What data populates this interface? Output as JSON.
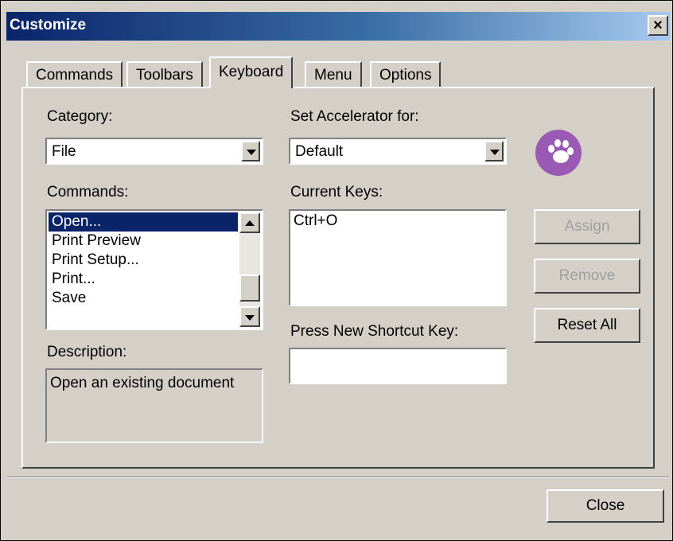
{
  "window": {
    "title": "Customize"
  },
  "tabs": [
    {
      "label": "Commands"
    },
    {
      "label": "Toolbars"
    },
    {
      "label": "Keyboard"
    },
    {
      "label": "Menu"
    },
    {
      "label": "Options"
    }
  ],
  "active_tab": "Keyboard",
  "category": {
    "label": "Category:",
    "value": "File"
  },
  "commands": {
    "label": "Commands:",
    "items": [
      "Open...",
      "Print Preview",
      "Print Setup...",
      "Print...",
      "Save"
    ],
    "selected": "Open..."
  },
  "description": {
    "label": "Description:",
    "text": "Open an existing document"
  },
  "accelerator": {
    "label": "Set Accelerator for:",
    "value": "Default"
  },
  "current_keys": {
    "label": "Current Keys:",
    "items": [
      "Ctrl+O"
    ]
  },
  "shortcut": {
    "label": "Press New Shortcut Key:",
    "value": ""
  },
  "buttons": {
    "assign": "Assign",
    "remove": "Remove",
    "reset_all": "Reset All",
    "close": "Close"
  },
  "colors": {
    "title_start": "#0a246a",
    "title_end": "#a6caf0",
    "selection": "#0a246a",
    "logo": "#9b59b6"
  },
  "icons": {
    "logo": "paw-icon"
  }
}
